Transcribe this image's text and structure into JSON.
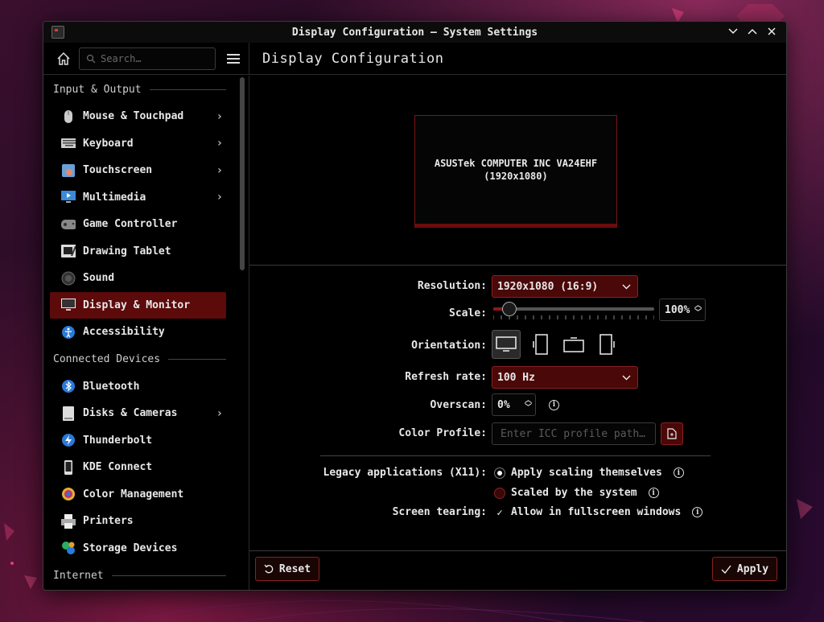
{
  "window": {
    "title": "Display Configuration — System Settings",
    "controls": [
      "minimize",
      "maximize",
      "close"
    ]
  },
  "toolbar": {
    "search_placeholder": "Search…",
    "page_title": "Display Configuration"
  },
  "sidebar": {
    "sections": [
      {
        "header": "Input & Output",
        "items": [
          {
            "label": "Mouse & Touchpad",
            "icon": "mouse-icon",
            "chevron": true
          },
          {
            "label": "Keyboard",
            "icon": "keyboard-icon",
            "chevron": true
          },
          {
            "label": "Touchscreen",
            "icon": "touchscreen-icon",
            "chevron": true
          },
          {
            "label": "Multimedia",
            "icon": "multimedia-icon",
            "chevron": true
          },
          {
            "label": "Game Controller",
            "icon": "gamepad-icon",
            "chevron": false
          },
          {
            "label": "Drawing Tablet",
            "icon": "tablet-icon",
            "chevron": false
          },
          {
            "label": "Sound",
            "icon": "speaker-icon",
            "chevron": false
          },
          {
            "label": "Display & Monitor",
            "icon": "monitor-icon",
            "chevron": false,
            "active": true
          },
          {
            "label": "Accessibility",
            "icon": "accessibility-icon",
            "chevron": false
          }
        ]
      },
      {
        "header": "Connected Devices",
        "items": [
          {
            "label": "Bluetooth",
            "icon": "bluetooth-icon",
            "chevron": false
          },
          {
            "label": "Disks & Cameras",
            "icon": "disk-icon",
            "chevron": true
          },
          {
            "label": "Thunderbolt",
            "icon": "thunderbolt-icon",
            "chevron": false
          },
          {
            "label": "KDE Connect",
            "icon": "phone-icon",
            "chevron": false
          },
          {
            "label": "Color Management",
            "icon": "color-icon",
            "chevron": false
          },
          {
            "label": "Printers",
            "icon": "printer-icon",
            "chevron": false
          },
          {
            "label": "Storage Devices",
            "icon": "storage-icon",
            "chevron": false
          }
        ]
      },
      {
        "header": "Internet",
        "items": []
      }
    ]
  },
  "monitor": {
    "name": "ASUSTek COMPUTER INC VA24EHF",
    "resolution": "(1920x1080)"
  },
  "form": {
    "resolution_label": "Resolution:",
    "resolution_value": "1920x1080 (16:9)",
    "scale_label": "Scale:",
    "scale_value": "100%",
    "scale_fraction": 0.1,
    "orientation_label": "Orientation:",
    "refresh_label": "Refresh rate:",
    "refresh_value": "100 Hz",
    "overscan_label": "Overscan:",
    "overscan_value": "0%",
    "color_profile_label": "Color Profile:",
    "color_profile_placeholder": "Enter ICC profile path…",
    "legacy_label": "Legacy applications (X11):",
    "legacy_option1": "Apply scaling themselves",
    "legacy_option2": "Scaled by the system",
    "tearing_label": "Screen tearing:",
    "tearing_option": "Allow in fullscreen windows"
  },
  "footer": {
    "reset_label": "Reset",
    "apply_label": "Apply"
  },
  "colors": {
    "accent": "#5c0a0a",
    "accent_border": "#8a2020",
    "background": "#000000"
  }
}
